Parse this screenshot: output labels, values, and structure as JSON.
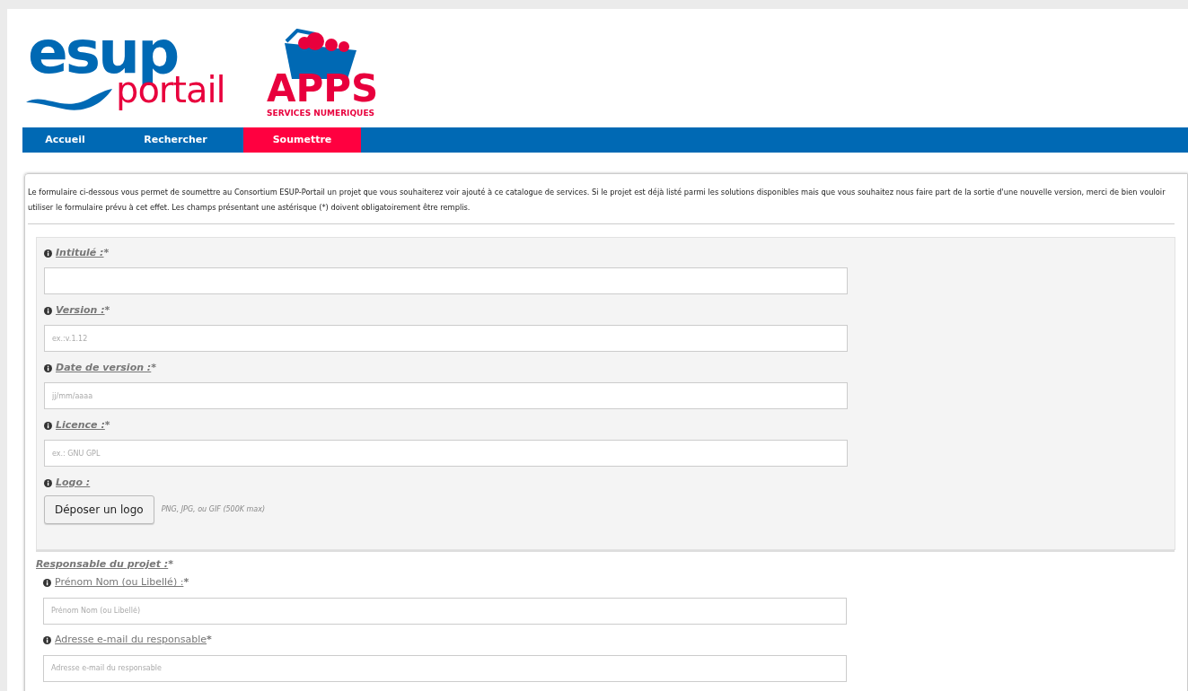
{
  "logos": {
    "esup": "esup",
    "portail": "portail",
    "apps": "APPS",
    "apps_subtitle": "SERVICES NUMERIQUES"
  },
  "nav": [
    {
      "label": "Accueil",
      "selected": false
    },
    {
      "label": "Rechercher",
      "selected": false
    },
    {
      "label": "Soumettre",
      "selected": true
    }
  ],
  "intro": "Le formulaire ci-dessous vous permet de soumettre au Consortium ESUP-Portail un projet que vous souhaiterez voir ajouté à ce catalogue de services. Si le projet est déjà listé parmi les solutions disponibles mais que vous souhaitez nous faire part de la sortie d'une nouvelle version, merci de bien vouloir utiliser le formulaire prévu à cet effet. Les champs présentant une astérisque (*) doivent obligatoirement être remplis.",
  "project_fields": [
    {
      "kind": "text",
      "label": "Intitulé :",
      "required_mark": "*"
    },
    {
      "kind": "text",
      "label": "Version :",
      "required_mark": "*",
      "placeholder": "ex.:v.1.12"
    },
    {
      "kind": "text",
      "label": "Date de version :",
      "required_mark": "*",
      "placeholder": "jj/mm/aaaa"
    },
    {
      "kind": "text",
      "label": "Licence :",
      "required_mark": "*",
      "placeholder": "ex.: GNU GPL"
    },
    {
      "kind": "file",
      "label": "Logo :",
      "button": "Déposer un logo",
      "hint": "PNG, JPG, ou GIF (500K max)"
    }
  ],
  "responsable": {
    "title": "Responsable du projet :",
    "required_mark": "*",
    "fields": [
      {
        "kind": "text",
        "label": "Prénom Nom (ou Libellé) :",
        "required_mark": "*",
        "placeholder": "Prénom Nom (ou Libellé)"
      },
      {
        "kind": "text",
        "label": "Adresse e-mail du responsable",
        "required_mark": "*",
        "placeholder": "Adresse e-mail du responsable"
      }
    ]
  }
}
